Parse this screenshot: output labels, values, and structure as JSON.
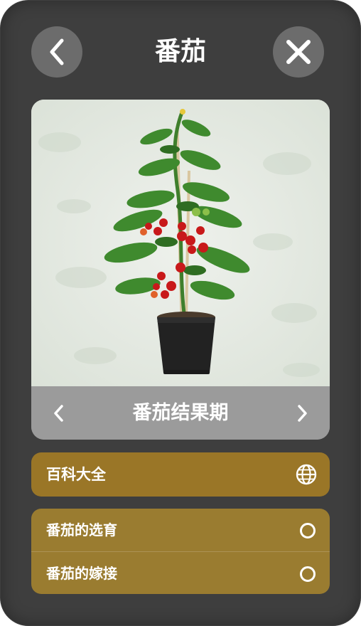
{
  "header": {
    "title": "番茄",
    "back_icon": "chevron-left-icon",
    "close_icon": "close-icon"
  },
  "gallery": {
    "caption": "番茄结果期",
    "prev_icon": "chevron-left-icon",
    "next_icon": "chevron-right-icon",
    "image_subject": "potted cherry tomato plant"
  },
  "encyclopedia": {
    "label": "百科大全",
    "icon": "globe-icon"
  },
  "topics": [
    {
      "label": "番茄的选育",
      "icon": "circle-icon"
    },
    {
      "label": "番茄的嫁接",
      "icon": "circle-icon"
    }
  ],
  "colors": {
    "panel": "#3e3e3e",
    "button": "#6c6c6c",
    "accent": "#9a7627"
  }
}
